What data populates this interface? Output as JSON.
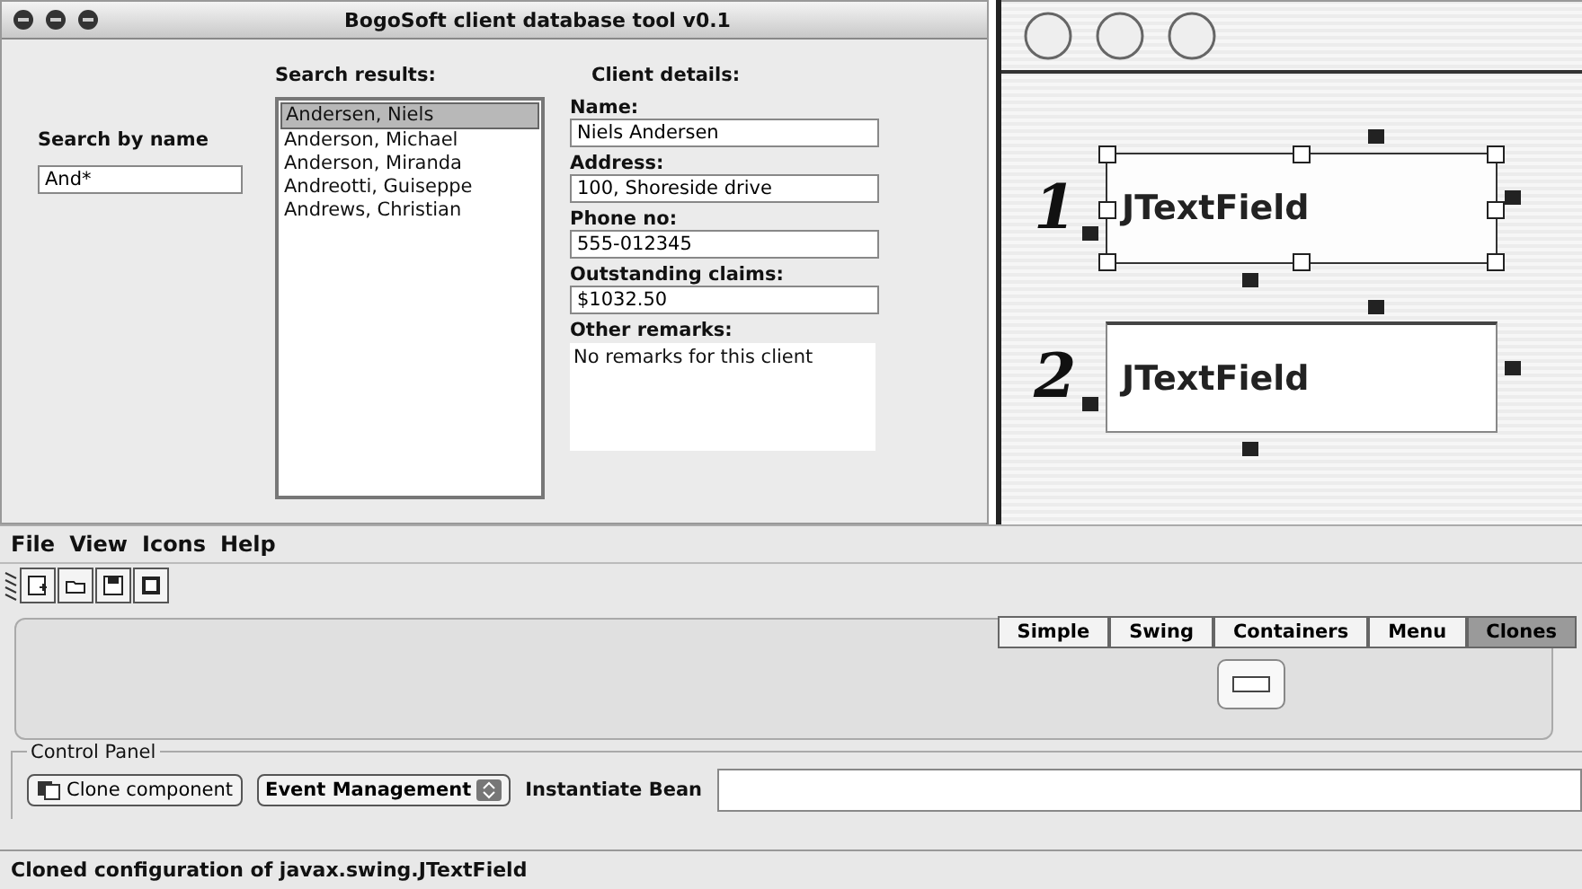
{
  "window": {
    "title": "BogoSoft client database tool v0.1"
  },
  "search": {
    "label": "Search by name",
    "value": "And*"
  },
  "results": {
    "label": "Search results:",
    "items": [
      {
        "name": "Andersen, Niels",
        "selected": true
      },
      {
        "name": "Anderson, Michael",
        "selected": false
      },
      {
        "name": "Anderson, Miranda",
        "selected": false
      },
      {
        "name": "Andreotti, Guiseppe",
        "selected": false
      },
      {
        "name": "Andrews, Christian",
        "selected": false
      }
    ]
  },
  "details": {
    "label": "Client details:",
    "fields": [
      {
        "label": "Name:",
        "value": "Niels Andersen"
      },
      {
        "label": "Address:",
        "value": "100, Shoreside drive"
      },
      {
        "label": "Phone no:",
        "value": "555-012345"
      },
      {
        "label": "Outstanding claims:",
        "value": "$1032.50"
      }
    ],
    "remarks": {
      "label": "Other remarks:",
      "value": "No remarks for this client"
    }
  },
  "canvas": {
    "components": [
      {
        "number": "1",
        "label": "JTextField",
        "selected": true
      },
      {
        "number": "2",
        "label": "JTextField",
        "selected": false
      }
    ]
  },
  "menu": [
    "File",
    "View",
    "Icons",
    "Help"
  ],
  "palette": {
    "tabs": [
      {
        "label": "Simple",
        "selected": false
      },
      {
        "label": "Swing",
        "selected": false
      },
      {
        "label": "Containers",
        "selected": false
      },
      {
        "label": "Menu",
        "selected": false
      },
      {
        "label": "Clones",
        "selected": true
      }
    ]
  },
  "control_panel": {
    "title": "Control Panel",
    "clone_button": "Clone component",
    "event_select": "Event Management",
    "instantiate_label": "Instantiate Bean"
  },
  "status_bar": "Cloned configuration of javax.swing.JTextField"
}
